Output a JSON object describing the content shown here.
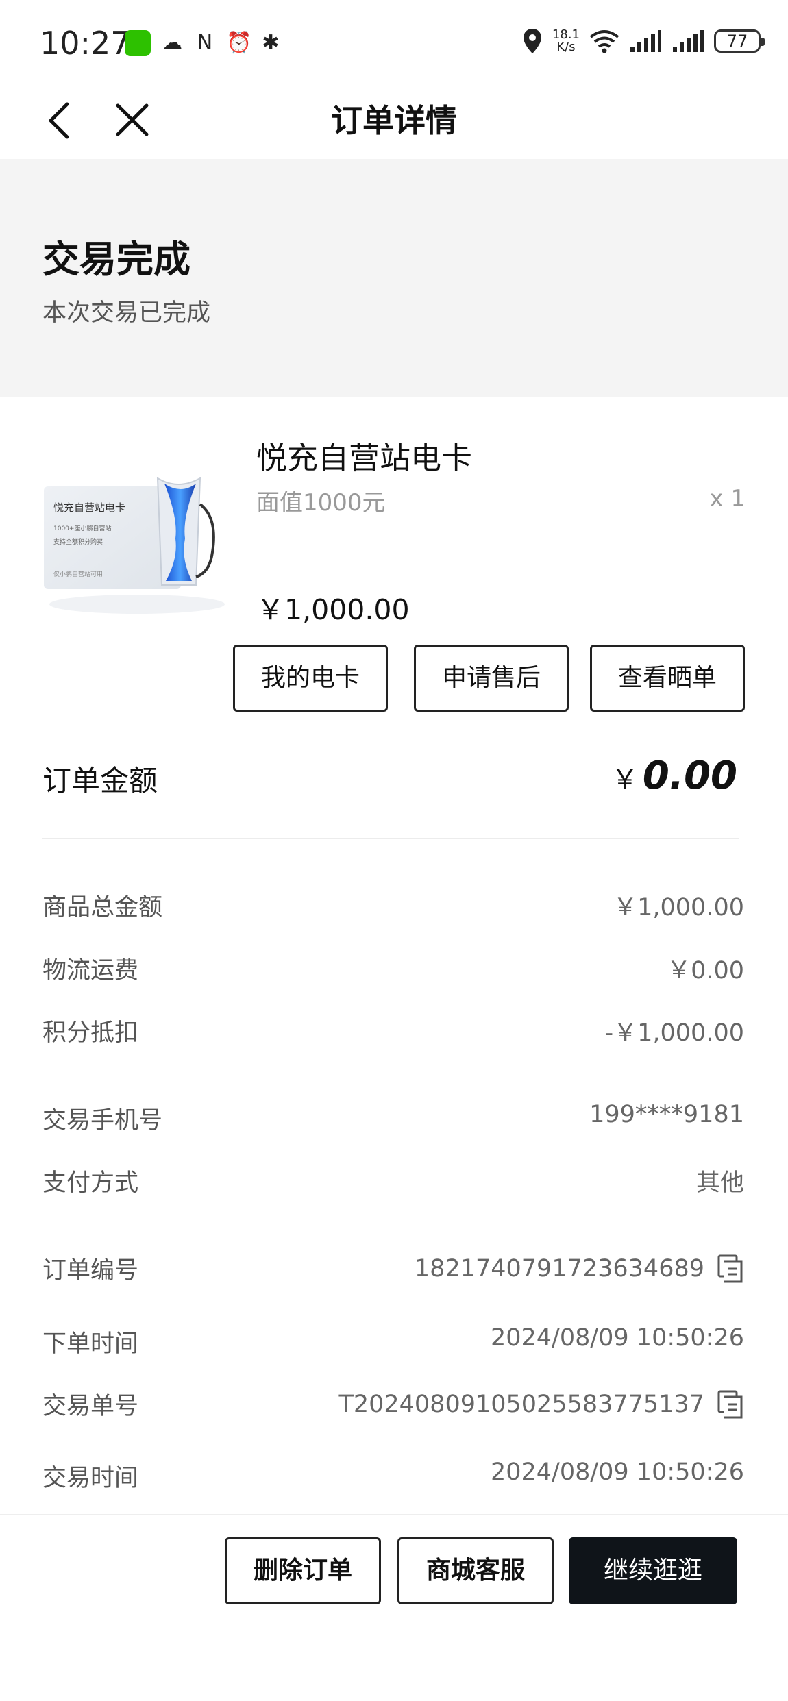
{
  "status_bar": {
    "time": "10:27",
    "net_speed_value": "18.1",
    "net_speed_unit": "K/s",
    "battery": "77",
    "icons": [
      "wechat-icon",
      "weather-icon",
      "nfc-icon",
      "alarm-icon",
      "bluetooth-icon",
      "location-icon",
      "wifi-icon",
      "signal-icon",
      "signal-icon",
      "battery-icon"
    ]
  },
  "nav": {
    "title": "订单详情",
    "back_icon": "chevron-left-icon",
    "close_icon": "close-icon"
  },
  "order_status": {
    "title": "交易完成",
    "subtitle": "本次交易已完成"
  },
  "product": {
    "name": "悦充自营站电卡",
    "spec": "面值1000元",
    "quantity": "x 1",
    "price": "￥1,000.00",
    "image_caption": "悦充自营站电卡",
    "image_lines": [
      "1000+座小鹏自营站",
      "支持全额积分购买",
      "仅小鹏自营站可用"
    ]
  },
  "item_actions": [
    "我的电卡",
    "申请售后",
    "查看晒单"
  ],
  "order_amount": {
    "label": "订单金额",
    "currency": "￥",
    "value": "0.00"
  },
  "price_breakdown": [
    {
      "label": "商品总金额",
      "value": "￥1,000.00"
    },
    {
      "label": "物流运费",
      "value": "￥0.00"
    },
    {
      "label": "积分抵扣",
      "value": "-￥1,000.00"
    }
  ],
  "payment_info": [
    {
      "label": "交易手机号",
      "value": "199****9181"
    },
    {
      "label": "支付方式",
      "value": "其他"
    }
  ],
  "order_info": [
    {
      "label": "订单编号",
      "value": "1821740791723634689",
      "copy": true
    },
    {
      "label": "下单时间",
      "value": "2024/08/09 10:50:26",
      "copy": false
    },
    {
      "label": "交易单号",
      "value": "T20240809105025583775137",
      "copy": true
    },
    {
      "label": "交易时间",
      "value": "2024/08/09 10:50:26",
      "copy": false
    }
  ],
  "bottom_actions": {
    "delete": "删除订单",
    "service": "商城客服",
    "continue": "继续逛逛"
  },
  "colors": {
    "primary_button": "#0f1419",
    "banner_bg": "#f4f4f4"
  }
}
